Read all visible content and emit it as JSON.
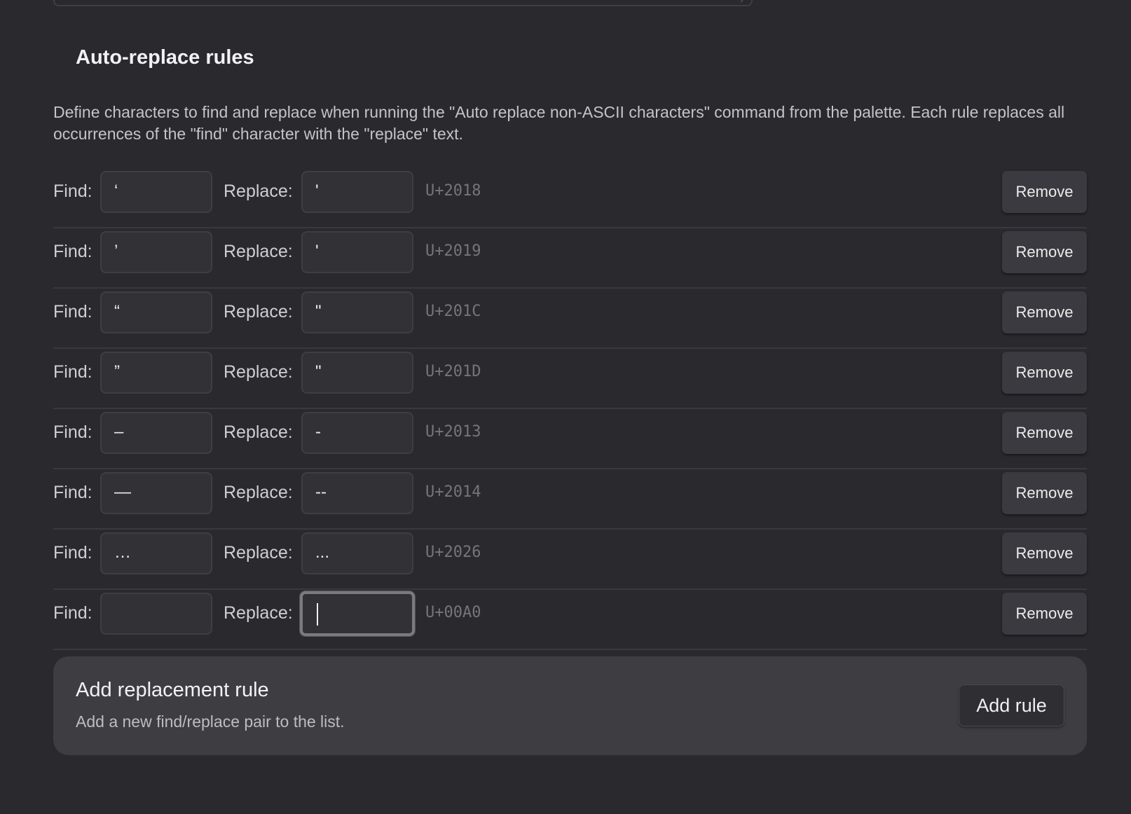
{
  "section": {
    "title": "Auto-replace rules",
    "description": "Define characters to find and replace when running the \"Auto replace non-ASCII characters\" command from the palette. Each rule replaces all occurrences of the \"find\" character with the \"replace\" text."
  },
  "labels": {
    "find": "Find:",
    "replace": "Replace:",
    "remove": "Remove"
  },
  "rules": [
    {
      "find": "‘",
      "replace": "'",
      "code": "U+2018"
    },
    {
      "find": "’",
      "replace": "'",
      "code": "U+2019"
    },
    {
      "find": "“",
      "replace": "\"",
      "code": "U+201C"
    },
    {
      "find": "”",
      "replace": "\"",
      "code": "U+201D"
    },
    {
      "find": "–",
      "replace": "-",
      "code": "U+2013"
    },
    {
      "find": "—",
      "replace": "--",
      "code": "U+2014"
    },
    {
      "find": "…",
      "replace": "...",
      "code": "U+2026"
    },
    {
      "find": " ",
      "replace": "",
      "code": "U+00A0",
      "focused": true
    }
  ],
  "add_rule": {
    "title": "Add replacement rule",
    "description": "Add a new find/replace pair to the list.",
    "button_label": "Add rule"
  }
}
